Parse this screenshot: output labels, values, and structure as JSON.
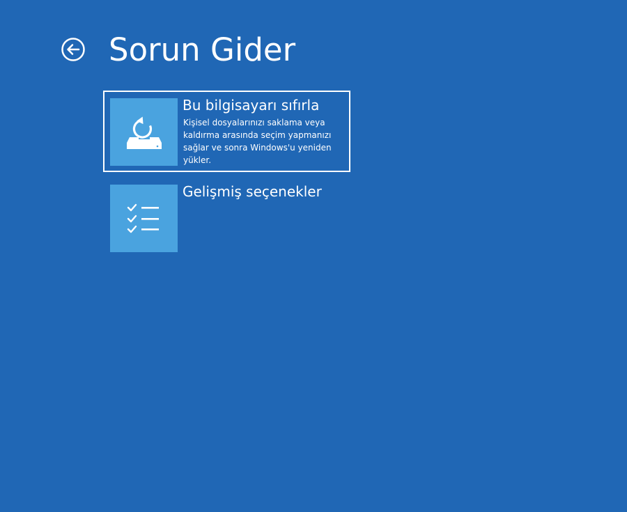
{
  "header": {
    "title": "Sorun Gider",
    "back_icon": "back-arrow-circle-icon"
  },
  "options": [
    {
      "title": "Bu bilgisayarı sıfırla",
      "description": "Kişisel dosyalarınızı saklama veya kaldırma arasında seçim yapmanızı sağlar ve sonra Windows'u yeniden yükler.",
      "icon": "reset-pc-icon",
      "selected": true
    },
    {
      "title": "Gelişmiş seçenekler",
      "description": "",
      "icon": "checklist-icon",
      "selected": false
    }
  ],
  "colors": {
    "background": "#2067b5",
    "tile": "#4aa3df",
    "text": "#ffffff",
    "selection_border": "#ffffff"
  }
}
